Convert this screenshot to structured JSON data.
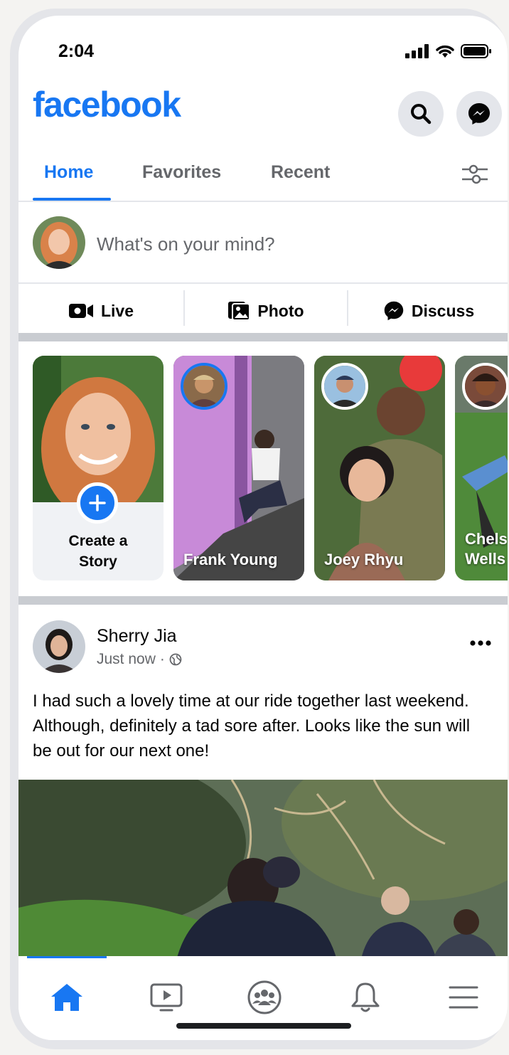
{
  "status_bar": {
    "time": "2:04"
  },
  "header": {
    "brand": "facebook"
  },
  "tabs": [
    {
      "label": "Home",
      "active": true
    },
    {
      "label": "Favorites",
      "active": false
    },
    {
      "label": "Recent",
      "active": false
    }
  ],
  "composer": {
    "placeholder": "What's on your mind?"
  },
  "actions": [
    {
      "label": "Live",
      "icon": "live-video-icon"
    },
    {
      "label": "Photo",
      "icon": "photo-icon"
    },
    {
      "label": "Discuss",
      "icon": "messenger-icon"
    }
  ],
  "stories": {
    "create_line1": "Create a",
    "create_line2": "Story",
    "items": [
      {
        "name": "Frank Young"
      },
      {
        "name": "Joey Rhyu"
      },
      {
        "name_line1": "Chels",
        "name_line2": "Wells"
      }
    ]
  },
  "post": {
    "author": "Sherry Jia",
    "time": "Just now",
    "separator": "·",
    "text": "I had such a lovely time at our ride together last weekend. Although, definitely a tad sore after. Looks like the sun will be out for our next one!"
  },
  "colors": {
    "brand": "#1877f2",
    "text": "#050505",
    "secondary": "#65676b"
  },
  "bottom_nav": [
    {
      "icon": "home-icon",
      "active": true
    },
    {
      "icon": "watch-icon",
      "active": false
    },
    {
      "icon": "groups-icon",
      "active": false
    },
    {
      "icon": "bell-icon",
      "active": false
    },
    {
      "icon": "menu-icon",
      "active": false
    }
  ]
}
